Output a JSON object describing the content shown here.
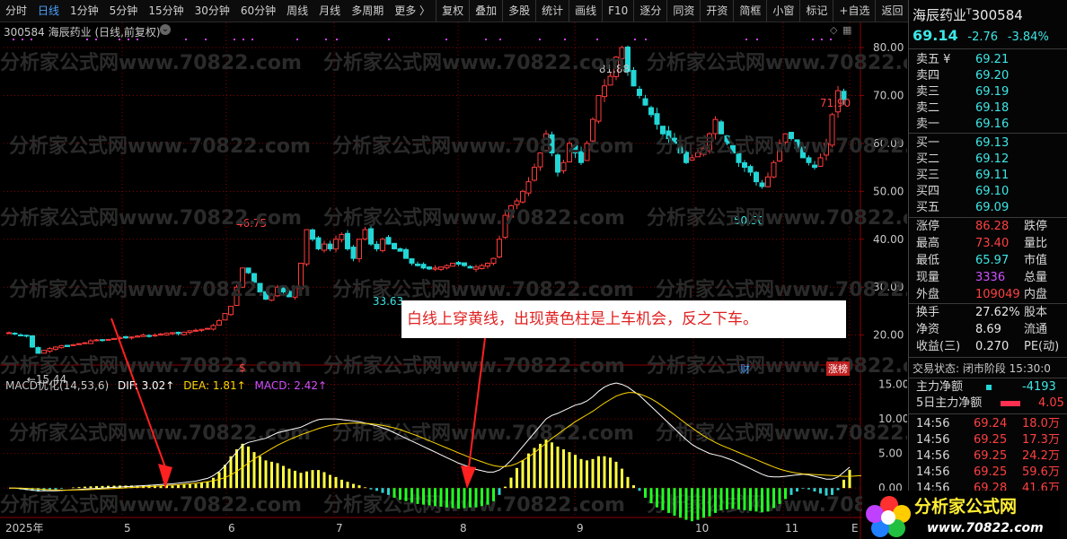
{
  "toolbar": {
    "items": [
      "分时",
      "日线",
      "1分钟",
      "5分钟",
      "15分钟",
      "30分钟",
      "60分钟",
      "周线",
      "月线",
      "多周期",
      "更多",
      "复权",
      "叠加",
      "多股",
      "统计",
      "画线",
      "F10",
      "逐分",
      "同资",
      "开资",
      "简框",
      "小窗",
      "标记",
      "+自选",
      "返回"
    ],
    "more_arrow": "〉"
  },
  "chart_header": {
    "code_name": "300584 海辰药业 (日线,前复权)",
    "macd_label": "MACD优化(14,53,6)",
    "dif": "DIF: 3.02↑",
    "dea": "DEA: 1.81↑",
    "macd": "MACD: 2.42↑"
  },
  "watermark": "分析家公式网www.70822.com",
  "annotation": "白线上穿黄线，出现黄色柱是上车机会，反之下车。",
  "markers": {
    "fin": "财",
    "zt": "涨榜",
    "s": "$"
  },
  "colors": {
    "up": "#ff3b3b",
    "down": "#22d6d6",
    "dif": "#ffffff",
    "dea": "#ffd700",
    "macd_pos": "#ffff40",
    "macd_neg_small": "#30d0d0",
    "macd_neg_big": "#22ff22",
    "grid": "#8b0000"
  },
  "chart_data": [
    {
      "type": "candlestick",
      "y_ticks": [
        "80.00",
        "70.00",
        "60.00",
        "50.00",
        "40.00",
        "30.00",
        "20.00"
      ],
      "ylim": [
        16,
        83
      ],
      "x_ticks": [
        "2025年",
        "5",
        "6",
        "7",
        "8",
        "9",
        "10",
        "11",
        "E"
      ],
      "price_labels": {
        "low1": "15.44",
        "high1": "46.75",
        "low2": "33.63",
        "high2": "81.88",
        "low3": "50.50",
        "high3": "71.90"
      },
      "series_close": [
        20.5,
        20.2,
        20.0,
        19.8,
        17.5,
        16.2,
        16.8,
        17.2,
        17.5,
        17.8,
        17.6,
        18.0,
        18.2,
        18.4,
        18.8,
        19.0,
        18.9,
        19.1,
        19.3,
        19.5,
        19.4,
        19.6,
        19.8,
        20.0,
        19.8,
        20.0,
        20.2,
        20.4,
        20.5,
        20.3,
        20.6,
        20.9,
        21.0,
        21.2,
        21.4,
        22.0,
        23.0,
        24.5,
        26.0,
        30.0,
        34.0,
        33.0,
        31.0,
        29.0,
        27.5,
        28.5,
        30.0,
        29.0,
        28.0,
        30.0,
        35.0,
        42.0,
        40.0,
        38.0,
        39.0,
        38.0,
        40.0,
        41.0,
        38.0,
        36.0,
        40.0,
        42.0,
        39.0,
        38.0,
        40.0,
        39.0,
        38.0,
        37.5,
        36.0,
        35.0,
        34.5,
        34.0,
        33.8,
        34.0,
        34.2,
        34.5,
        35.0,
        34.8,
        34.5,
        34.0,
        34.2,
        34.5,
        35.0,
        36.0,
        40.0,
        45.0,
        47.0,
        48.0,
        50.0,
        52.0,
        55.0,
        58.0,
        62.0,
        58.0,
        54.0,
        56.0,
        60.0,
        58.0,
        56.0,
        60.0,
        65.0,
        70.0,
        72.0,
        74.0,
        78.0,
        80.0,
        75.0,
        72.0,
        70.0,
        68.0,
        66.0,
        64.0,
        62.0,
        61.0,
        60.0,
        58.0,
        56.0,
        57.0,
        58.0,
        59.0,
        62.0,
        65.0,
        62.0,
        60.0,
        58.0,
        56.0,
        55.0,
        54.0,
        52.0,
        51.0,
        53.0,
        56.0,
        60.0,
        62.0,
        61.0,
        59.0,
        57.0,
        56.0,
        55.0,
        57.0,
        60.0,
        66.0,
        71.0,
        69.14
      ],
      "values_note": "",
      "dif": [
        0.0,
        0.0,
        -0.1,
        -0.2,
        -0.3,
        -0.4,
        -0.4,
        -0.4,
        -0.4,
        -0.35,
        -0.3,
        -0.25,
        -0.2,
        -0.15,
        -0.1,
        -0.05,
        0.0,
        0.05,
        0.1,
        0.15,
        0.2,
        0.25,
        0.3,
        0.35,
        0.4,
        0.45,
        0.5,
        0.55,
        0.6,
        0.7,
        0.8,
        0.9,
        1.0,
        1.2,
        1.4,
        1.8,
        2.4,
        3.2,
        4.2,
        5.2,
        6.2,
        6.6,
        6.8,
        7.0,
        7.2,
        7.6,
        8.0,
        8.2,
        8.4,
        8.6,
        8.8,
        9.2,
        9.6,
        9.9,
        10.0,
        10.0,
        10.0,
        9.9,
        9.8,
        9.7,
        9.6,
        9.4,
        9.2,
        9.0,
        8.7,
        8.4,
        8.0,
        7.6,
        7.2,
        6.8,
        6.4,
        6.0,
        5.6,
        5.2,
        4.8,
        4.4,
        4.0,
        3.6,
        3.3,
        3.0,
        2.7,
        2.5,
        2.3,
        2.3,
        2.6,
        3.2,
        4.0,
        5.0,
        6.0,
        7.0,
        8.0,
        9.0,
        10.0,
        10.5,
        10.8,
        11.2,
        11.6,
        12.0,
        12.2,
        12.6,
        13.2,
        14.0,
        14.6,
        15.0,
        15.2,
        15.0,
        14.6,
        14.0,
        13.4,
        12.6,
        11.8,
        11.0,
        10.2,
        9.4,
        8.6,
        7.8,
        7.0,
        6.3,
        5.8,
        5.4,
        5.0,
        4.8,
        4.6,
        4.3,
        4.0,
        3.6,
        3.2,
        2.8,
        2.4,
        2.0,
        1.7,
        1.6,
        1.6,
        1.7,
        1.8,
        1.9,
        2.0,
        1.9,
        1.7,
        1.5,
        1.3,
        1.3,
        1.6,
        2.3,
        3.02
      ],
      "dea": [
        0.0,
        0.0,
        0.0,
        -0.05,
        -0.1,
        -0.15,
        -0.2,
        -0.25,
        -0.28,
        -0.3,
        -0.3,
        -0.29,
        -0.27,
        -0.25,
        -0.22,
        -0.19,
        -0.15,
        -0.11,
        -0.07,
        -0.03,
        0.02,
        0.07,
        0.12,
        0.17,
        0.22,
        0.27,
        0.32,
        0.37,
        0.42,
        0.48,
        0.55,
        0.62,
        0.7,
        0.8,
        0.92,
        1.06,
        1.25,
        1.52,
        1.9,
        2.4,
        3.0,
        3.6,
        4.2,
        4.7,
        5.2,
        5.7,
        6.2,
        6.6,
        7.0,
        7.35,
        7.7,
        8.0,
        8.3,
        8.6,
        8.85,
        9.05,
        9.2,
        9.3,
        9.35,
        9.4,
        9.4,
        9.35,
        9.3,
        9.2,
        9.05,
        8.9,
        8.7,
        8.45,
        8.15,
        7.85,
        7.55,
        7.2,
        6.85,
        6.5,
        6.15,
        5.8,
        5.45,
        5.1,
        4.75,
        4.4,
        4.1,
        3.8,
        3.5,
        3.25,
        3.1,
        3.1,
        3.25,
        3.55,
        4.0,
        4.5,
        5.1,
        5.8,
        6.5,
        7.2,
        7.8,
        8.4,
        9.0,
        9.6,
        10.1,
        10.6,
        11.1,
        11.7,
        12.3,
        12.8,
        13.3,
        13.6,
        13.8,
        13.8,
        13.6,
        13.3,
        12.9,
        12.4,
        11.8,
        11.2,
        10.6,
        9.95,
        9.3,
        8.7,
        8.1,
        7.55,
        7.05,
        6.6,
        6.2,
        5.85,
        5.5,
        5.15,
        4.8,
        4.45,
        4.1,
        3.75,
        3.4,
        3.05,
        2.75,
        2.5,
        2.3,
        2.15,
        2.05,
        2.0,
        1.95,
        1.9,
        1.85,
        1.8,
        1.75,
        1.7,
        1.7,
        1.75,
        1.81
      ],
      "macd_y_ticks": [
        "15.00",
        "10.00",
        "5.00",
        "0.00"
      ],
      "macd_ylim": [
        -4,
        16.5
      ]
    }
  ],
  "side": {
    "title": "海辰药业",
    "tmark": "T",
    "code": "300584",
    "price": "69.14",
    "change": "-2.76",
    "pct": "-3.84%",
    "asks": [
      {
        "l": "卖五 ¥",
        "v": "69.21"
      },
      {
        "l": "卖四",
        "v": "69.20"
      },
      {
        "l": "卖三",
        "v": "69.19"
      },
      {
        "l": "卖二",
        "v": "69.18"
      },
      {
        "l": "卖一",
        "v": "69.16"
      }
    ],
    "bids": [
      {
        "l": "买一",
        "v": "69.13"
      },
      {
        "l": "买二",
        "v": "69.12"
      },
      {
        "l": "买三",
        "v": "69.11"
      },
      {
        "l": "买四",
        "v": "69.10"
      },
      {
        "l": "买五",
        "v": "69.09"
      }
    ],
    "stats": [
      {
        "l": "涨停",
        "v": "86.28",
        "r": "跌停"
      },
      {
        "l": "最高",
        "v": "73.40",
        "r": "量比"
      },
      {
        "l": "最低",
        "v": "65.97",
        "r": "市值"
      },
      {
        "l": "现量",
        "v": "3336",
        "r": "总量"
      },
      {
        "l": "外盘",
        "v": "109049",
        "r": "内盘"
      }
    ],
    "stats2": [
      {
        "l": "换手",
        "v": "27.62%",
        "r": "股本"
      },
      {
        "l": "净资",
        "v": "8.69",
        "r": "流通"
      },
      {
        "l": "收益(三)",
        "v": "0.270",
        "r": "PE(动)"
      }
    ],
    "trade_status": "交易状态: 闭市阶段 15:30:0",
    "main_net": {
      "l": "主力净额",
      "v": "-4193"
    },
    "main_net5": {
      "l": "5日主力净额",
      "v": "4.05"
    },
    "ticks": [
      {
        "t": "14:56",
        "p": "69.24",
        "v": "18.0万"
      },
      {
        "t": "14:56",
        "p": "69.25",
        "v": "17.3万"
      },
      {
        "t": "14:56",
        "p": "69.25",
        "v": "24.2万"
      },
      {
        "t": "14:56",
        "p": "69.25",
        "v": "59.6万"
      },
      {
        "t": "14:56",
        "p": "69.28",
        "v": "41.6万"
      }
    ]
  },
  "logo": {
    "text": "分析家公式网",
    "url": "www.70822.com"
  }
}
